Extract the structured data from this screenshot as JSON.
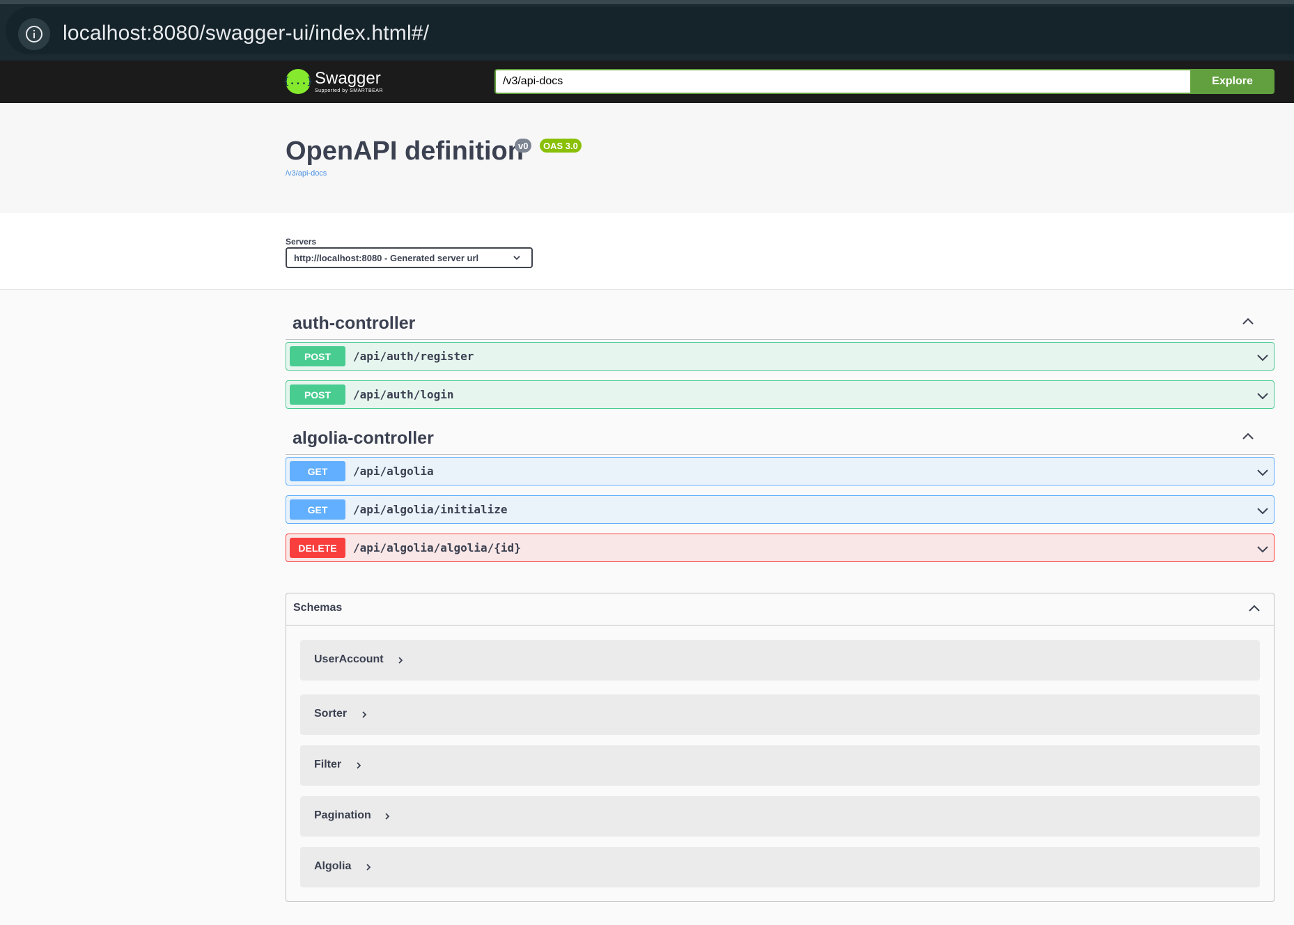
{
  "browser": {
    "url": "localhost:8080/swagger-ui/index.html#/",
    "info_icon": "info-icon"
  },
  "topbar": {
    "logo_name": "Swagger",
    "logo_sub": "Supported by SMARTBEAR",
    "logo_mark": "{...}",
    "spec_url": "/v3/api-docs",
    "explore_label": "Explore"
  },
  "info": {
    "title": "OpenAPI definition",
    "version": "v0",
    "oas": "OAS 3.0",
    "spec_link": "/v3/api-docs"
  },
  "servers": {
    "label": "Servers",
    "selected": "http://localhost:8080 - Generated server url"
  },
  "tags": [
    {
      "name": "auth-controller",
      "operations": [
        {
          "method": "POST",
          "path": "/api/auth/register"
        },
        {
          "method": "POST",
          "path": "/api/auth/login"
        }
      ]
    },
    {
      "name": "algolia-controller",
      "operations": [
        {
          "method": "GET",
          "path": "/api/algolia"
        },
        {
          "method": "GET",
          "path": "/api/algolia/initialize"
        },
        {
          "method": "DELETE",
          "path": "/api/algolia/algolia/{id}"
        }
      ]
    }
  ],
  "schemas": {
    "title": "Schemas",
    "models": [
      "UserAccount",
      "Sorter",
      "Filter",
      "Pagination",
      "Algolia"
    ]
  },
  "colors": {
    "post": "#49cc90",
    "get": "#61affe",
    "delete": "#f93e3e",
    "explore": "#62a03f",
    "logo": "#85ea2d"
  }
}
